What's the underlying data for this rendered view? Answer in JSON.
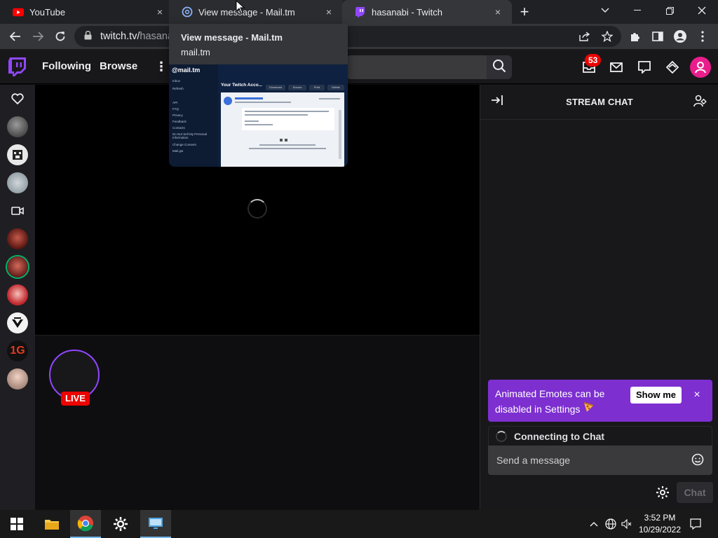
{
  "browser": {
    "tabs": [
      {
        "title": "YouTube",
        "icon": "youtube-favicon",
        "close": "×",
        "state": "inactive"
      },
      {
        "title": "View message - Mail.tm",
        "icon": "mailtm-favicon",
        "close": "×",
        "state": "hover"
      },
      {
        "title": "hasanabi - Twitch",
        "icon": "twitch-favicon",
        "close": "×",
        "state": "active"
      }
    ],
    "new_tab": "+",
    "url_host": "twitch.tv/",
    "url_path": "hasana",
    "window_controls": [
      "chevron-down",
      "minimize",
      "restore",
      "close"
    ]
  },
  "tab_preview": {
    "title": "View message - Mail.tm",
    "url": "mail.tm",
    "thumbnail": {
      "logo": "@mail.tm",
      "sidebar_links": [
        "Inbox",
        "Refresh",
        "API",
        "FAQ",
        "Privacy",
        "Feedback",
        "Contacts",
        "Do Not Sell My Personal Information",
        "Change Consent",
        "Mail.gw"
      ],
      "heading": "Your Twitch Acco...",
      "actions": [
        "Download",
        "Source",
        "Print",
        "Delete"
      ]
    }
  },
  "twitch": {
    "nav": {
      "following": "Following",
      "browse": "Browse",
      "more": "⋮",
      "notification_count": "53"
    },
    "colors": {
      "brand": "#9147ff",
      "live": "#eb0400",
      "promo": "#7d2fd0",
      "avatar": "#e91e8c"
    },
    "live_label": "LIVE",
    "chat": {
      "title": "STREAM CHAT",
      "promo_text": "Animated Emotes can be disabled in Settings",
      "promo_button": "Show me",
      "promo_close": "×",
      "connecting": "Connecting to Chat",
      "placeholder": "Send a message",
      "send": "Chat"
    }
  },
  "taskbar": {
    "time": "3:52 PM",
    "date": "10/29/2022",
    "apps": [
      "windows-start",
      "file-explorer",
      "chrome",
      "settings",
      "remote-desktop"
    ]
  }
}
